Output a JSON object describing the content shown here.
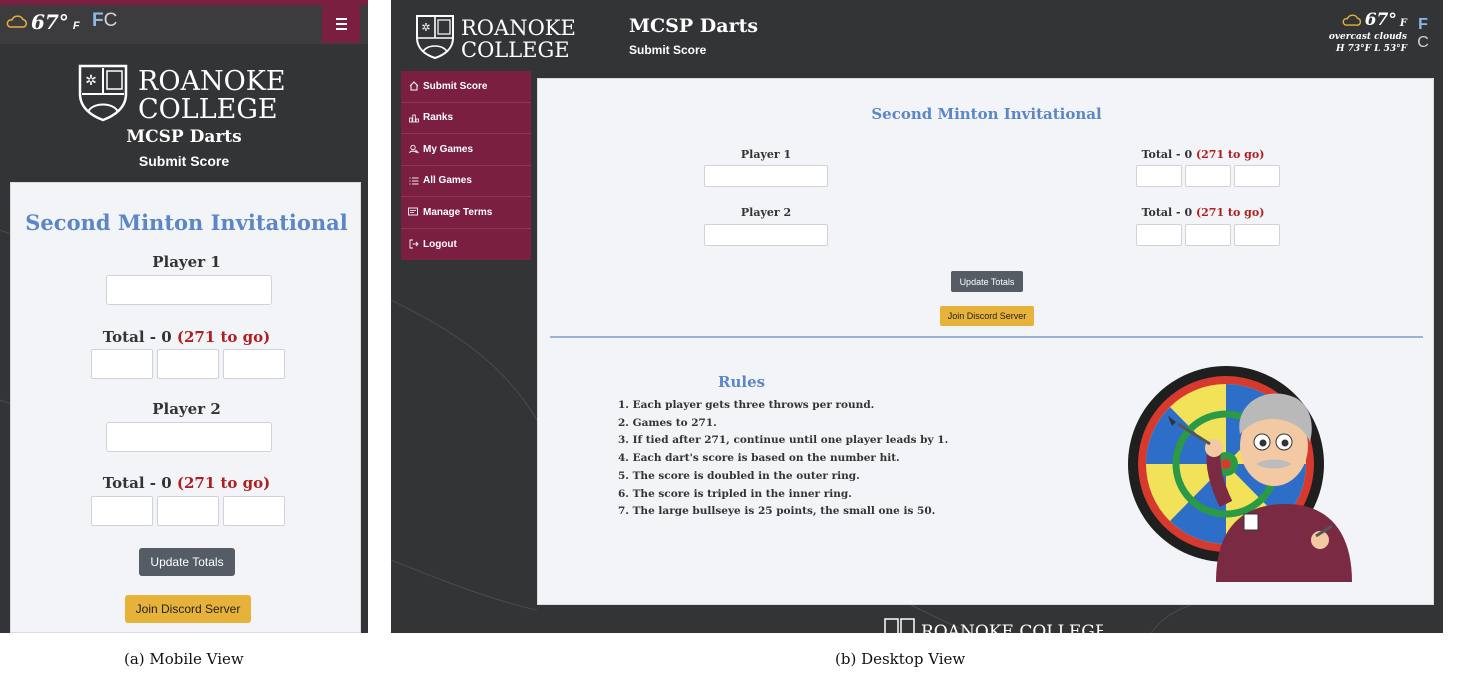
{
  "mobile": {
    "weather": {
      "temp": "67°",
      "unit_sub": "F",
      "unit_f": "F",
      "unit_c": "C"
    },
    "logo": {
      "line1": "ROANOKE",
      "line2": "COLLEGE"
    },
    "app_title": "MCSP Darts",
    "app_subtitle": "Submit Score",
    "event_title": "Second Minton Invitational",
    "player1_label": "Player 1",
    "player2_label": "Player 2",
    "total1_prefix": "Total - 0 ",
    "total1_remaining": "(271 to go)",
    "total2_prefix": "Total - 0 ",
    "total2_remaining": "(271 to go)",
    "update_button": "Update Totals",
    "discord_button": "Join Discord Server"
  },
  "desktop": {
    "logo": {
      "line1": "ROANOKE",
      "line2": "COLLEGE"
    },
    "app_title": "MCSP Darts",
    "app_subtitle": "Submit Score",
    "weather": {
      "temp": "67°",
      "unit_sub": "F",
      "description": "overcast clouds",
      "high_low": "H 73°F L 53°F",
      "unit_f": "F",
      "unit_c": "C"
    },
    "nav": [
      {
        "label": "Submit Score",
        "icon": "home-icon"
      },
      {
        "label": "Ranks",
        "icon": "ranks-icon"
      },
      {
        "label": "My Games",
        "icon": "person-search-icon"
      },
      {
        "label": "All Games",
        "icon": "list-icon"
      },
      {
        "label": "Manage Terms",
        "icon": "terms-icon"
      },
      {
        "label": "Logout",
        "icon": "logout-icon"
      }
    ],
    "event_title": "Second Minton Invitational",
    "player1_label": "Player 1",
    "player2_label": "Player 2",
    "total1_prefix": "Total - 0 ",
    "total1_remaining": "(271 to go)",
    "total2_prefix": "Total - 0 ",
    "total2_remaining": "(271 to go)",
    "update_button": "Update Totals",
    "discord_button": "Join Discord Server",
    "rules_title": "Rules",
    "rules": [
      "1. Each player gets three throws per round.",
      "2. Games to 271.",
      "3. If tied after 271, continue until one player leads by 1.",
      "4. Each dart's score is based on the number hit.",
      "5. The score is doubled in the outer ring.",
      "6. The score is tripled in the inner ring.",
      "7. The large bullseye is 25 points, the small one is 50."
    ],
    "footer_logo": "ROANOKE COLLEGE"
  },
  "captions": {
    "mobile": "(a) Mobile View",
    "desktop": "(b) Desktop View"
  },
  "colors": {
    "maroon": "#7a1f3f",
    "dark_bg": "#333436",
    "title_blue": "#5b87c4",
    "remaining_red": "#b01f1f",
    "discord_yellow": "#e6b23a",
    "update_gray": "#555c66"
  }
}
